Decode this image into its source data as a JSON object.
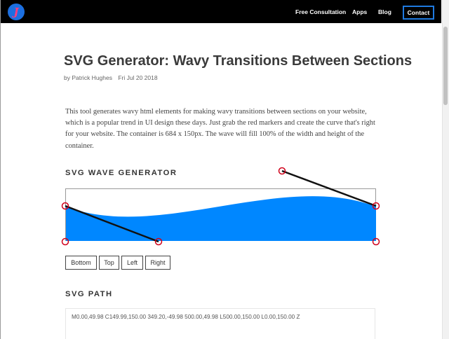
{
  "nav": {
    "logo_glyph": "J",
    "links": [
      "Free Consultation",
      "Apps",
      "Blog"
    ],
    "contact_label": "Contact",
    "accent_color": "#1f7ae0"
  },
  "article": {
    "title": "SVG Generator: Wavy Transitions Between Sections",
    "author": "by Patrick Hughes",
    "date": "Fri Jul 20 2018",
    "intro": "This tool generates wavy html elements for making wavy transitions between sections on your website, which is a popular trend in UI design these days. Just grab the red markers and create the curve that's right for your website. The container is 684 x 150px. The wave will fill 100% of the width and height of the container."
  },
  "generator": {
    "heading": "SVG WAVE GENERATOR",
    "wave_color": "#0087ff",
    "marker_color": "#d0021b",
    "buttons": [
      "Bottom",
      "Top",
      "Left",
      "Right"
    ]
  },
  "path_section": {
    "heading": "SVG PATH",
    "path_value": "M0.00,49.98 C149.99,150.00 349.20,-49.98 500.00,49.98 L500.00,150.00 L0.00,150.00 Z"
  }
}
